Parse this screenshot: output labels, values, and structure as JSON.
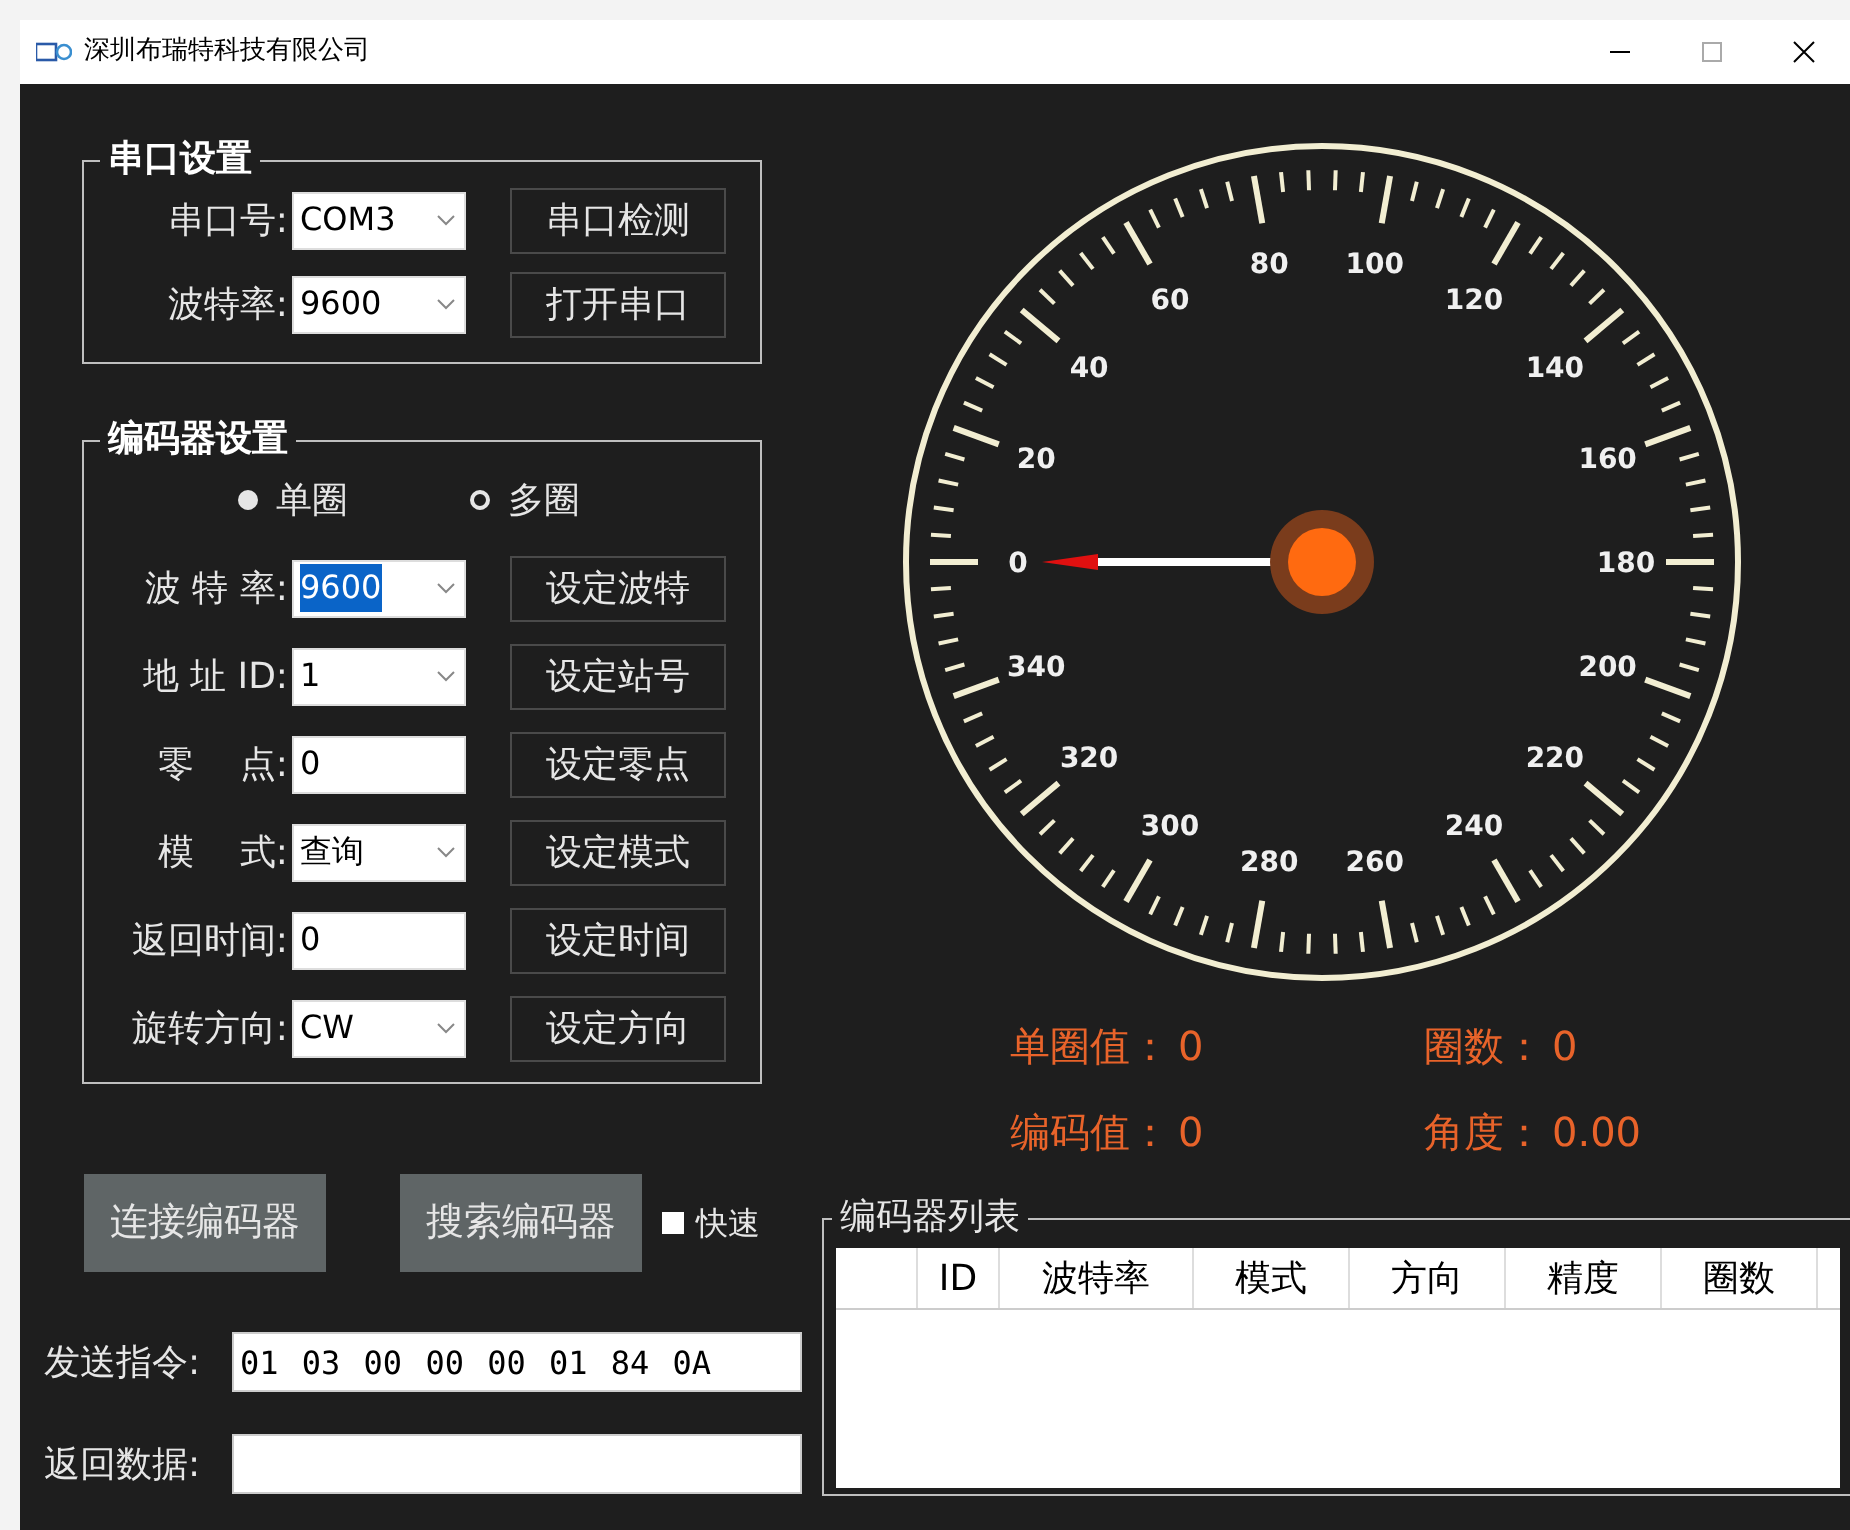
{
  "window": {
    "title": "深圳布瑞特科技有限公司"
  },
  "serial_settings": {
    "title": "串口设置",
    "rows": [
      {
        "label": "串口号:",
        "kind": "combo",
        "value": "COM3",
        "highlighted": false,
        "button": "串口检测"
      },
      {
        "label": "波特率:",
        "kind": "combo",
        "value": "9600",
        "highlighted": false,
        "button": "打开串口"
      }
    ]
  },
  "encoder_settings": {
    "title": "编码器设置",
    "modes": [
      {
        "label": "单圈",
        "selected": true
      },
      {
        "label": "多圈",
        "selected": false
      }
    ],
    "rows": [
      {
        "label": "波 特 率:",
        "kind": "combo",
        "value": "9600",
        "highlighted": true,
        "button": "设定波特"
      },
      {
        "label": "地 址 ID:",
        "kind": "combo",
        "value": "1",
        "highlighted": false,
        "button": "设定站号"
      },
      {
        "label": "零    点:",
        "kind": "text",
        "value": "0",
        "highlighted": false,
        "button": "设定零点"
      },
      {
        "label": "模    式:",
        "kind": "combo",
        "value": "查询",
        "highlighted": false,
        "button": "设定模式"
      },
      {
        "label": "返回时间:",
        "kind": "text",
        "value": "0",
        "highlighted": false,
        "button": "设定时间"
      },
      {
        "label": "旋转方向:",
        "kind": "combo",
        "value": "CW",
        "highlighted": false,
        "button": "设定方向"
      }
    ]
  },
  "actions": {
    "buttons": [
      "连接编码器",
      "搜索编码器"
    ],
    "fast": {
      "label": "快速",
      "checked": true
    }
  },
  "commands": [
    {
      "label": "发送指令:",
      "value": "01 03 00 00 00 01 84 0A"
    },
    {
      "label": "返回数据:"
    }
  ],
  "dial": {
    "labels": [
      "0",
      "20",
      "40",
      "60",
      "80",
      "100",
      "120",
      "140",
      "160",
      "180",
      "200",
      "220",
      "240",
      "260",
      "280",
      "300",
      "320",
      "340"
    ]
  },
  "readouts": [
    {
      "label": "单圈值：",
      "value": "0"
    },
    {
      "label": "圈数：",
      "value": "0"
    },
    {
      "label": "编码值：",
      "value": "0"
    },
    {
      "label": "角度：",
      "value": "0.00"
    }
  ],
  "encoder_list": {
    "title": "编码器列表",
    "columns": [
      "ID",
      "波特率",
      "模式",
      "方向",
      "精度",
      "圈数"
    ]
  }
}
